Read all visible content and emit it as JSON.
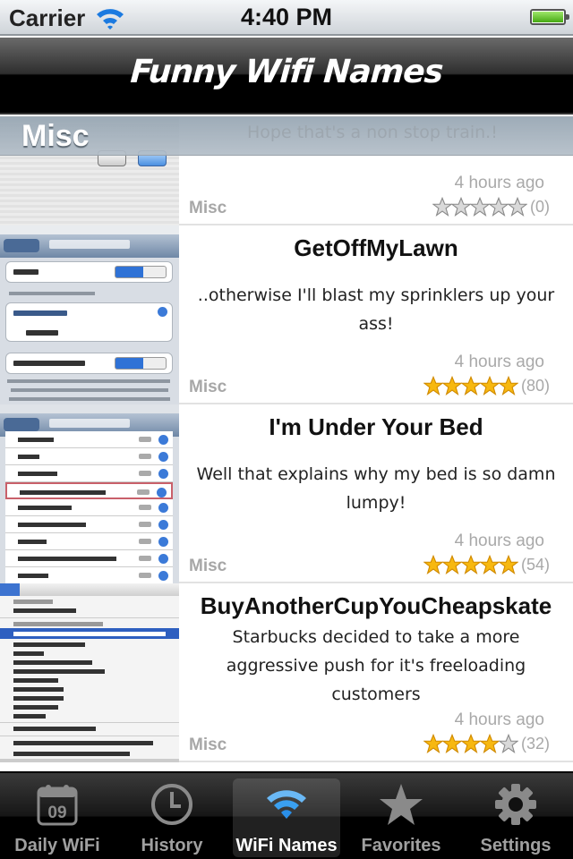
{
  "status_bar": {
    "carrier": "Carrier",
    "time": "4:40 PM",
    "battery_level": 1.0
  },
  "nav": {
    "title": "Funny Wifi Names"
  },
  "section": {
    "title": "Misc",
    "ghost_text": "Hope that's a non stop train.!"
  },
  "rows": [
    {
      "title": "",
      "description": "",
      "time": "4 hours ago",
      "category": "Misc",
      "rating": 0,
      "rating_count": "(0)",
      "thumbnail": "mac-toolbar-screenshot"
    },
    {
      "title": "GetOffMyLawn",
      "description": "..otherwise I'll blast my sprinklers up your ass!",
      "time": "4 hours ago",
      "category": "Misc",
      "rating": 5,
      "rating_count": "(80)",
      "thumbnail": "ios-wifi-settings-screenshot"
    },
    {
      "title": "I'm Under Your Bed",
      "description": "Well that explains why my bed is so damn lumpy!",
      "time": "4 hours ago",
      "category": "Misc",
      "rating": 5,
      "rating_count": "(54)",
      "thumbnail": "ios-network-list-screenshot"
    },
    {
      "title": "BuyAnotherCupYouCheapskate",
      "description": "Starbucks decided to take a more aggressive push for it's freeloading customers",
      "time": "4 hours ago",
      "category": "Misc",
      "rating": 4,
      "rating_count": "(32)",
      "thumbnail": "mac-wifi-menu-screenshot"
    }
  ],
  "colors": {
    "star_filled": "#f7b810",
    "star_empty": "#d9d9d9",
    "tab_selected_icon": "#3aa0f0"
  },
  "tabs": [
    {
      "label": "Daily WiFi",
      "icon": "calendar-icon",
      "calendar_day": "09",
      "selected": false
    },
    {
      "label": "History",
      "icon": "clock-icon",
      "selected": false
    },
    {
      "label": "WiFi Names",
      "icon": "wifi-icon",
      "selected": true
    },
    {
      "label": "Favorites",
      "icon": "star-icon",
      "selected": false
    },
    {
      "label": "Settings",
      "icon": "gear-icon",
      "selected": false
    }
  ]
}
